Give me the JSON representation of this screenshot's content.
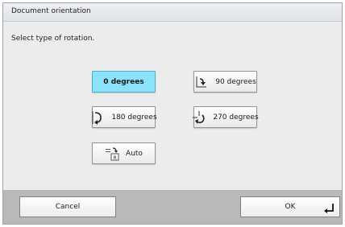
{
  "dialog": {
    "title": "Document orientation",
    "instruction": "Select type of rotation."
  },
  "options": [
    {
      "label": "0 degrees",
      "icon": "none",
      "selected": true
    },
    {
      "label": "90 degrees",
      "icon": "rotate-90-icon",
      "selected": false
    },
    {
      "label": "180 degrees",
      "icon": "rotate-180-icon",
      "selected": false
    },
    {
      "label": "270 degrees",
      "icon": "rotate-270-icon",
      "selected": false
    },
    {
      "label": "Auto",
      "icon": "auto-rotate-icon",
      "selected": false
    }
  ],
  "footer": {
    "cancel_label": "Cancel",
    "ok_label": "OK"
  },
  "colors": {
    "selected": "#8be3fb",
    "footer": "#b9b9b9",
    "dialog_bg": "#ececec"
  }
}
